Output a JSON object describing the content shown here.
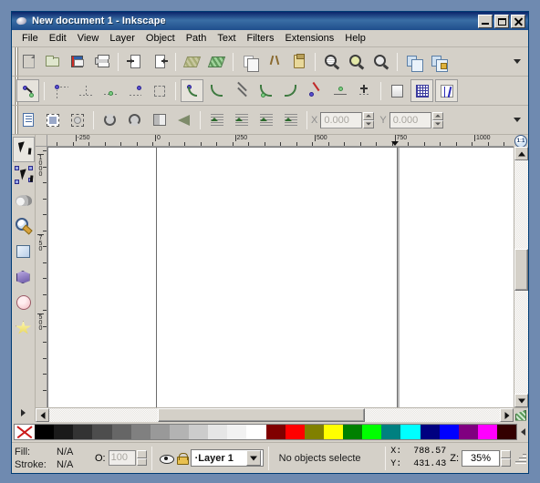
{
  "window": {
    "title": "New document 1 - Inkscape",
    "app_icon": "inkscape-logo-icon",
    "controls": {
      "minimize": "_",
      "maximize": "▢",
      "close": "✕"
    }
  },
  "menu": {
    "items": [
      {
        "label": "File",
        "accel": "F"
      },
      {
        "label": "Edit",
        "accel": "E"
      },
      {
        "label": "View",
        "accel": "V"
      },
      {
        "label": "Layer",
        "accel": "L"
      },
      {
        "label": "Object",
        "accel": "O"
      },
      {
        "label": "Path",
        "accel": "P"
      },
      {
        "label": "Text",
        "accel": "T"
      },
      {
        "label": "Filters",
        "accel": "s"
      },
      {
        "label": "Extensions",
        "accel": "n"
      },
      {
        "label": "Help",
        "accel": "H"
      }
    ]
  },
  "command_bar": {
    "overflow_label": "toolbar-overflow-chevron",
    "buttons": [
      {
        "name": "new-document-button",
        "icon": "new-document-icon"
      },
      {
        "name": "open-document-button",
        "icon": "open-folder-icon"
      },
      {
        "name": "save-document-button",
        "icon": "floppy-save-icon"
      },
      {
        "name": "print-document-button",
        "icon": "printer-icon"
      },
      {
        "name": "import-button",
        "icon": "import-arrow-icon"
      },
      {
        "name": "export-button",
        "icon": "export-arrow-icon"
      },
      {
        "name": "undo-button",
        "icon": "undo-icon"
      },
      {
        "name": "redo-button",
        "icon": "redo-icon"
      },
      {
        "name": "copy-button",
        "icon": "copy-icon"
      },
      {
        "name": "cut-button",
        "icon": "scissors-icon"
      },
      {
        "name": "paste-button",
        "icon": "clipboard-icon"
      },
      {
        "name": "zoom-selection-button",
        "icon": "zoom-selection-icon"
      },
      {
        "name": "zoom-drawing-button",
        "icon": "zoom-drawing-icon"
      },
      {
        "name": "zoom-page-button",
        "icon": "zoom-page-icon"
      },
      {
        "name": "group-button",
        "icon": "group-icon"
      },
      {
        "name": "ungroup-button",
        "icon": "ungroup-icon"
      }
    ]
  },
  "snap_bar": {
    "buttons": [
      {
        "name": "enable-snapping-toggle",
        "icon": "snap-master-icon",
        "active": true
      },
      {
        "name": "snap-bounding-box-toggle",
        "icon": "snap-bbox-icon"
      },
      {
        "name": "snap-bbox-edges-toggle",
        "icon": "snap-bbox-edge-icon"
      },
      {
        "name": "snap-bbox-corners-toggle",
        "icon": "snap-bbox-corner-icon"
      },
      {
        "name": "snap-bbox-midpoints-toggle",
        "icon": "snap-bbox-midpoint-icon"
      },
      {
        "name": "snap-bbox-center-toggle",
        "icon": "snap-bbox-center-icon"
      },
      {
        "name": "snap-nodes-toggle",
        "icon": "snap-node-icon",
        "active": true
      },
      {
        "name": "snap-paths-toggle",
        "icon": "snap-path-icon"
      },
      {
        "name": "snap-path-intersections-toggle",
        "icon": "snap-intersection-icon"
      },
      {
        "name": "snap-cusp-nodes-toggle",
        "icon": "snap-cusp-icon"
      },
      {
        "name": "snap-smooth-nodes-toggle",
        "icon": "snap-smooth-icon"
      },
      {
        "name": "snap-line-midpoints-toggle",
        "icon": "snap-midpoint-icon"
      },
      {
        "name": "snap-object-centers-toggle",
        "icon": "snap-center-icon"
      },
      {
        "name": "snap-rotation-center-toggle",
        "icon": "snap-rotation-icon"
      },
      {
        "name": "snap-page-border-toggle",
        "icon": "snap-page-border-icon"
      },
      {
        "name": "snap-grid-toggle",
        "icon": "snap-grid-icon",
        "active": true
      },
      {
        "name": "snap-guides-toggle",
        "icon": "snap-guide-icon",
        "active": true
      }
    ]
  },
  "selector_bar": {
    "buttons": [
      {
        "name": "select-all-button",
        "icon": "select-all-icon"
      },
      {
        "name": "select-all-layers-button",
        "icon": "select-all-layers-icon"
      },
      {
        "name": "deselect-button",
        "icon": "deselect-icon"
      },
      {
        "name": "rotate-ccw-button",
        "icon": "rotate-ccw-icon"
      },
      {
        "name": "rotate-cw-button",
        "icon": "rotate-cw-icon"
      },
      {
        "name": "flip-horizontal-button",
        "icon": "flip-horizontal-icon"
      },
      {
        "name": "flip-vertical-button",
        "icon": "flip-vertical-icon"
      },
      {
        "name": "lower-to-bottom-button",
        "icon": "lower-to-bottom-icon"
      },
      {
        "name": "lower-button",
        "icon": "lower-icon"
      },
      {
        "name": "raise-button",
        "icon": "raise-icon"
      },
      {
        "name": "raise-to-top-button",
        "icon": "raise-to-top-icon"
      }
    ],
    "x_field": {
      "label": "X",
      "value": "0.000",
      "enabled": false
    },
    "y_field": {
      "label": "Y",
      "value": "0.000",
      "enabled": false
    }
  },
  "toolbox": {
    "tools": [
      {
        "name": "selector-tool",
        "icon": "arrow-cursor-icon",
        "active": true
      },
      {
        "name": "node-tool",
        "icon": "node-editor-icon"
      },
      {
        "name": "tweak-tool",
        "icon": "tweak-icon"
      },
      {
        "name": "zoom-tool",
        "icon": "magnifier-icon"
      },
      {
        "name": "rectangle-tool",
        "icon": "rectangle-icon"
      },
      {
        "name": "box3d-tool",
        "icon": "3d-box-icon"
      },
      {
        "name": "ellipse-tool",
        "icon": "ellipse-icon"
      },
      {
        "name": "star-tool",
        "icon": "star-icon"
      }
    ],
    "overflow": "toolbox-overflow-arrow"
  },
  "rulers": {
    "unit": "px",
    "horizontal": {
      "labels": [
        "-250",
        "0",
        "250",
        "500",
        "750",
        "1000"
      ]
    },
    "vertical": {
      "labels": [
        "1000",
        "750",
        "500"
      ]
    },
    "zoom_corner_label": "1:1"
  },
  "canvas": {
    "page_left_edge_label": "page-left-border",
    "page_right_edge_label": "page-right-border",
    "background": "#ffffff"
  },
  "palette": {
    "none_swatch": "no-color-swatch",
    "grays": [
      "#000000",
      "#1a1a1a",
      "#333333",
      "#4d4d4d",
      "#666666",
      "#808080",
      "#999999",
      "#b3b3b3",
      "#cccccc",
      "#e6e6e6",
      "#f2f2f2",
      "#ffffff"
    ],
    "colors": [
      "#800000",
      "#ff0000",
      "#808000",
      "#ffff00",
      "#008000",
      "#00ff00",
      "#008080",
      "#00ffff",
      "#000080",
      "#0000ff",
      "#800080",
      "#ff00ff",
      "#330000"
    ],
    "scroll_arrow": "palette-scroll-arrow"
  },
  "status_bar": {
    "fill_label": "Fill:",
    "fill_value": "N/A",
    "stroke_label": "Stroke:",
    "stroke_value": "N/A",
    "opacity_label": "O:",
    "opacity_value": "100",
    "visibility_icon": "eye-icon",
    "lock_icon": "unlock-icon",
    "layer_name": "·Layer 1",
    "message": "No objects selecte",
    "x_label": "X:",
    "x_value": "788.57",
    "y_label": "Y:",
    "y_value": "431.43",
    "zoom_label": "Z:",
    "zoom_value": "35%",
    "resize_grip": "resize-grip-icon"
  }
}
